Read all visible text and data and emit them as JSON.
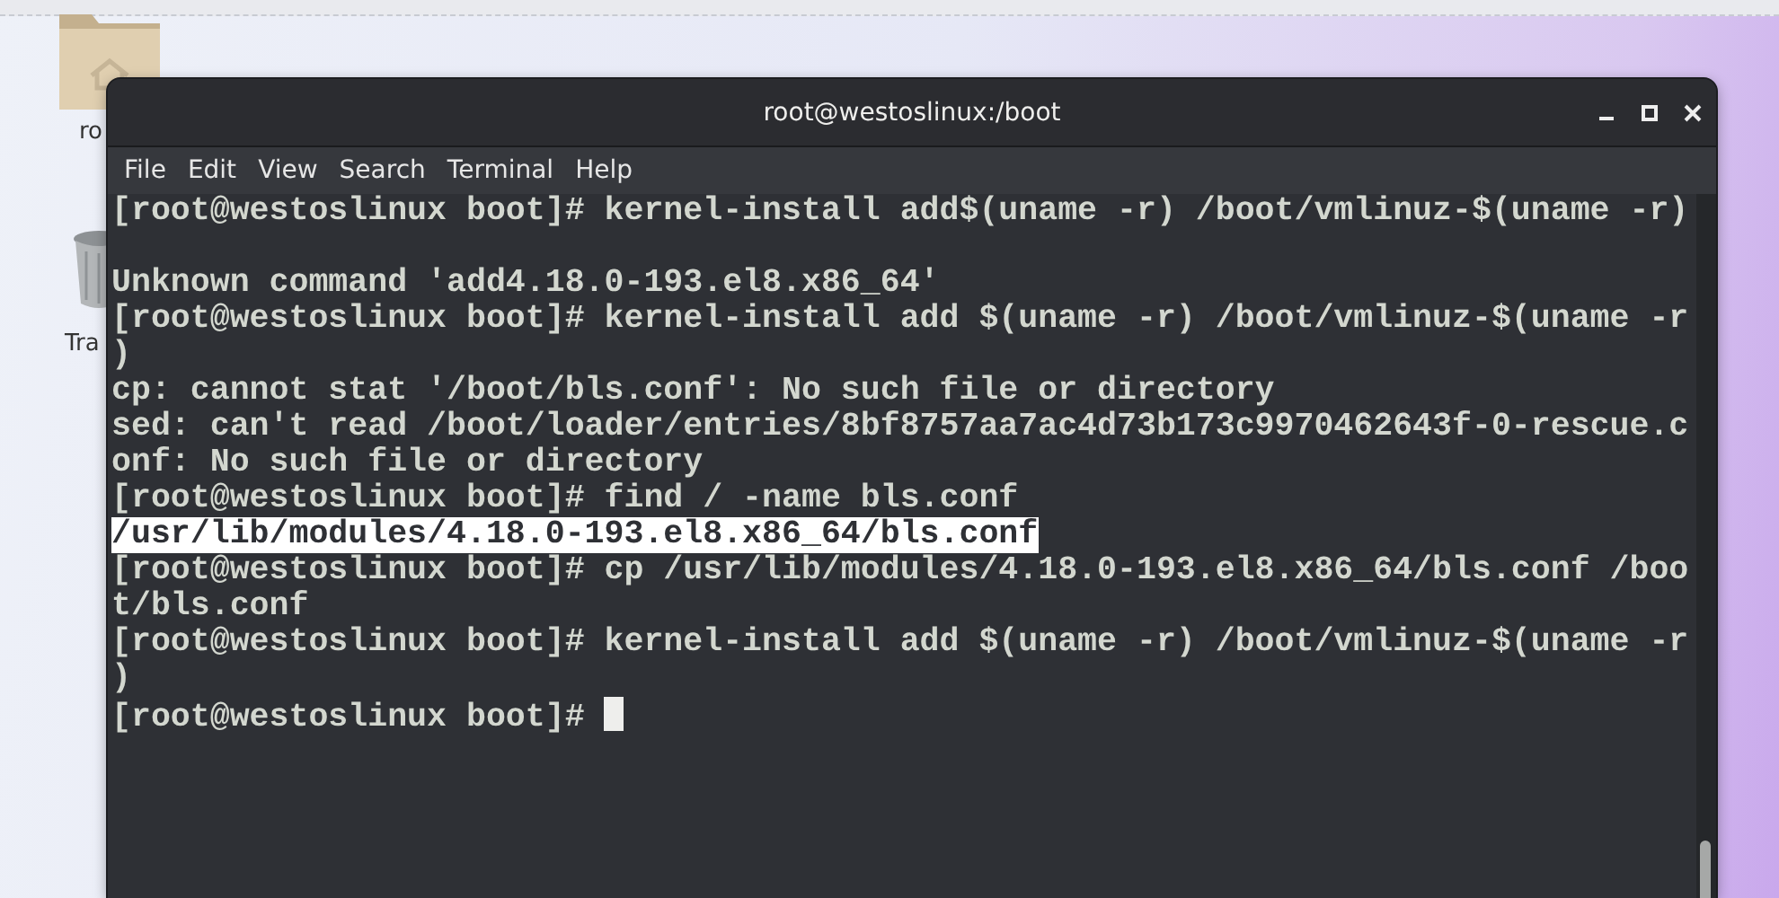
{
  "desktop": {
    "icons": [
      {
        "kind": "folder",
        "label": "ro"
      },
      {
        "kind": "trash",
        "label": "Tra"
      }
    ]
  },
  "window": {
    "title": "root@westoslinux:/boot"
  },
  "menu": [
    "File",
    "Edit",
    "View",
    "Search",
    "Terminal",
    "Help"
  ],
  "terminal": {
    "cursor_visible": true,
    "lines": [
      {
        "kind": "text",
        "text": "[root@westoslinux boot]# kernel-install add$(uname -r) /boot/vmlinuz-$(uname -r)",
        "selected": false
      },
      {
        "kind": "blank"
      },
      {
        "kind": "text",
        "text": "Unknown command 'add4.18.0-193.el8.x86_64'",
        "selected": false
      },
      {
        "kind": "text",
        "text": "[root@westoslinux boot]# kernel-install add $(uname -r) /boot/vmlinuz-$(uname -r",
        "selected": false
      },
      {
        "kind": "text",
        "text": ")",
        "selected": false
      },
      {
        "kind": "text",
        "text": "cp: cannot stat '/boot/bls.conf': No such file or directory",
        "selected": false
      },
      {
        "kind": "text",
        "text": "sed: can't read /boot/loader/entries/8bf8757aa7ac4d73b173c9970462643f-0-rescue.c",
        "selected": false
      },
      {
        "kind": "text",
        "text": "onf: No such file or directory",
        "selected": false
      },
      {
        "kind": "text",
        "text": "[root@westoslinux boot]# find / -name bls.conf",
        "selected": false
      },
      {
        "kind": "text",
        "text": "/usr/lib/modules/4.18.0-193.el8.x86_64/bls.conf",
        "selected": true
      },
      {
        "kind": "text",
        "text": "[root@westoslinux boot]# cp /usr/lib/modules/4.18.0-193.el8.x86_64/bls.conf /boo",
        "selected": false
      },
      {
        "kind": "text",
        "text": "t/bls.conf",
        "selected": false
      },
      {
        "kind": "text",
        "text": "[root@westoslinux boot]# kernel-install add $(uname -r) /boot/vmlinuz-$(uname -r",
        "selected": false
      },
      {
        "kind": "text",
        "text": ")",
        "selected": false
      },
      {
        "kind": "text",
        "text": "[root@westoslinux boot]# ",
        "selected": false
      }
    ]
  }
}
